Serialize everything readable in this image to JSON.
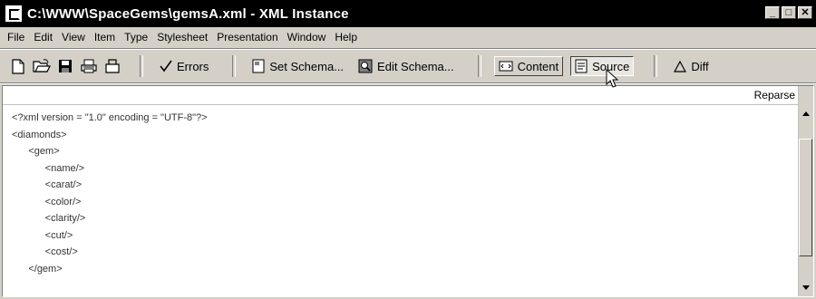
{
  "window": {
    "title": "C:\\WWW\\SpaceGems\\gemsA.xml - XML Instance",
    "controls": [
      "_",
      "□",
      "✕"
    ]
  },
  "menu": [
    {
      "label": "File"
    },
    {
      "label": "Edit"
    },
    {
      "label": "View"
    },
    {
      "label": "Item"
    },
    {
      "label": "Type"
    },
    {
      "label": "Stylesheet"
    },
    {
      "label": "Presentation"
    },
    {
      "label": "Window"
    },
    {
      "label": "Help"
    }
  ],
  "toolbar": {
    "icons": [
      "new-document-icon",
      "open-folder-icon",
      "save-icon",
      "print-icon",
      "clear-icon"
    ],
    "errors_label": "Errors",
    "set_schema_label": "Set Schema...",
    "edit_schema_label": "Edit Schema...",
    "content_label": "Content",
    "source_label": "Source",
    "diff_label": "Diff"
  },
  "editor": {
    "reparse_label": "Reparse",
    "lines": [
      "<?xml version = \"1.0\" encoding = \"UTF-8\"?>",
      "<diamonds>",
      "      <gem>",
      "            <name/>",
      "            <carat/>",
      "            <color/>",
      "            <clarity/>",
      "            <cut/>",
      "            <cost/>",
      "      </gem>"
    ]
  }
}
